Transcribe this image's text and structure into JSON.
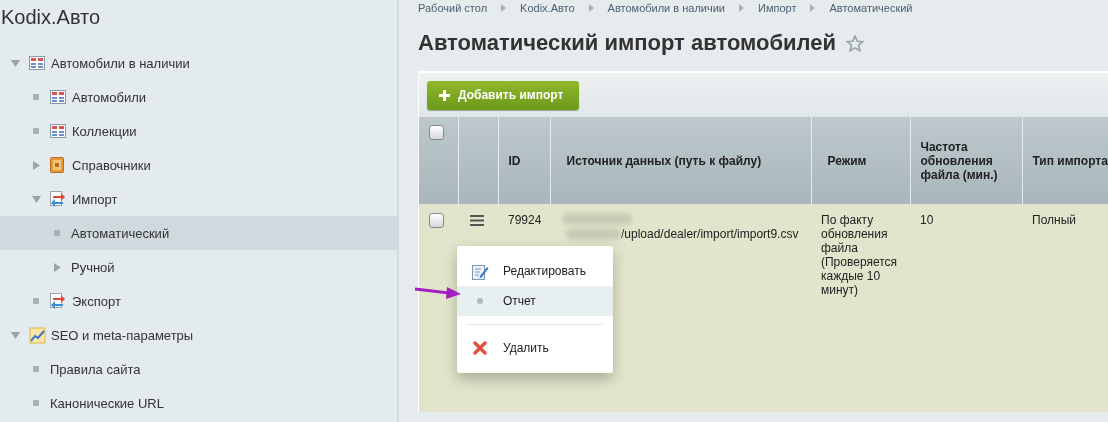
{
  "sidebar": {
    "title": "Kodix.Авто",
    "items": [
      {
        "label": "Автомобили в наличии",
        "kind": "table",
        "expanded": true,
        "selected": false,
        "children": [
          {
            "label": "Автомобили",
            "kind": "table",
            "selected": false
          },
          {
            "label": "Коллекции",
            "kind": "table",
            "selected": false
          },
          {
            "label": "Справочники",
            "kind": "book",
            "expanded": false,
            "selected": false
          },
          {
            "label": "Импорт",
            "kind": "transfer",
            "expanded": true,
            "selected": false,
            "children": [
              {
                "label": "Автоматический",
                "kind": "plain",
                "selected": true
              },
              {
                "label": "Ручной",
                "kind": "plain",
                "expanded": false,
                "selected": false
              }
            ]
          },
          {
            "label": "Экспорт",
            "kind": "transfer",
            "selected": false
          }
        ]
      },
      {
        "label": "SEO и meta-параметры",
        "kind": "seo",
        "expanded": true,
        "selected": false,
        "children": [
          {
            "label": "Правила сайта",
            "kind": "plain",
            "selected": false
          },
          {
            "label": "Канонические URL",
            "kind": "plain",
            "selected": false
          }
        ]
      }
    ]
  },
  "breadcrumbs": [
    "Рабочий стол",
    "Kodix.Авто",
    "Автомобили в наличии",
    "Импорт",
    "Автоматический"
  ],
  "page_title": "Автоматический импорт автомобилей",
  "toolbar": {
    "add_button": "Добавить импорт"
  },
  "table": {
    "header_checkbox": {
      "checked": false
    },
    "columns": [
      "ID",
      "Источник данных (путь к файлу)",
      "Режим",
      "Частота обновления файла (мин.)",
      "Тип импорта"
    ],
    "rows": [
      {
        "checked": false,
        "id": "79924",
        "source": "/upload/dealer/import/import9.csv",
        "mode": "По факту обновления файла (Проверяется каждые 10 минут)",
        "frequency": "10",
        "type": "Полный"
      }
    ]
  },
  "context_menu": {
    "items": [
      {
        "kind": "edit",
        "label": "Редактировать",
        "selected": false
      },
      {
        "kind": "dot",
        "label": "Отчет",
        "selected": true
      },
      {
        "kind": "separator"
      },
      {
        "kind": "delete",
        "label": "Удалить",
        "selected": false
      }
    ]
  }
}
